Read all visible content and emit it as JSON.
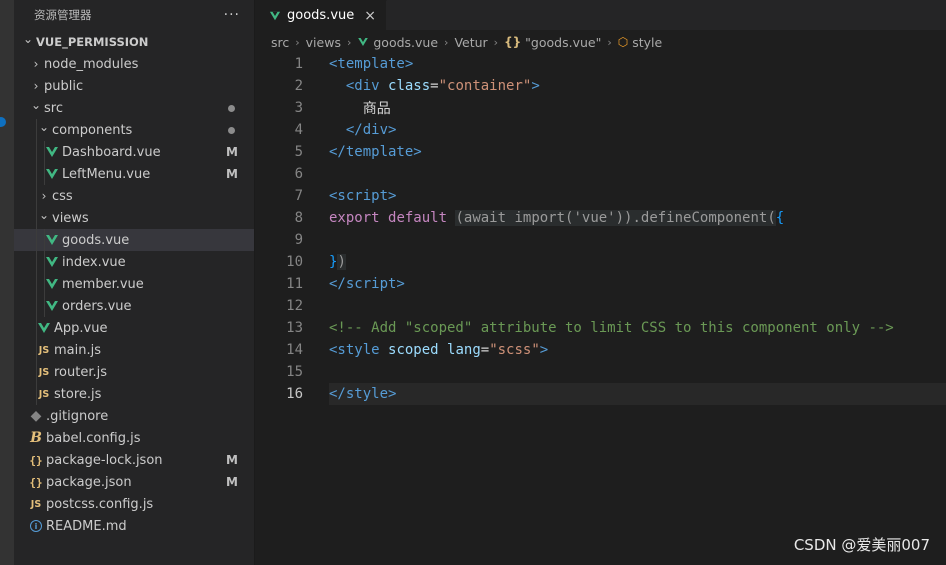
{
  "sidebar": {
    "title": "资源管理器",
    "more": "···",
    "tree": [
      {
        "label": "VUE_PERMISSION",
        "kind": "root",
        "depth": 0,
        "chevron": "open",
        "icon": "",
        "status": ""
      },
      {
        "label": "node_modules",
        "kind": "folder",
        "depth": 1,
        "chevron": "closed",
        "icon": "",
        "status": ""
      },
      {
        "label": "public",
        "kind": "folder",
        "depth": 1,
        "chevron": "closed",
        "icon": "",
        "status": ""
      },
      {
        "label": "src",
        "kind": "folder",
        "depth": 1,
        "chevron": "open",
        "icon": "",
        "status": "dot"
      },
      {
        "label": "components",
        "kind": "folder",
        "depth": 2,
        "chevron": "open",
        "icon": "",
        "status": "dot"
      },
      {
        "label": "Dashboard.vue",
        "kind": "file",
        "depth": 3,
        "chevron": "",
        "icon": "vue",
        "status": "M"
      },
      {
        "label": "LeftMenu.vue",
        "kind": "file",
        "depth": 3,
        "chevron": "",
        "icon": "vue",
        "status": "M"
      },
      {
        "label": "css",
        "kind": "folder",
        "depth": 2,
        "chevron": "closed",
        "icon": "",
        "status": ""
      },
      {
        "label": "views",
        "kind": "folder",
        "depth": 2,
        "chevron": "open",
        "icon": "",
        "status": ""
      },
      {
        "label": "goods.vue",
        "kind": "file",
        "depth": 3,
        "chevron": "",
        "icon": "vue",
        "status": "",
        "selected": true
      },
      {
        "label": "index.vue",
        "kind": "file",
        "depth": 3,
        "chevron": "",
        "icon": "vue",
        "status": ""
      },
      {
        "label": "member.vue",
        "kind": "file",
        "depth": 3,
        "chevron": "",
        "icon": "vue",
        "status": ""
      },
      {
        "label": "orders.vue",
        "kind": "file",
        "depth": 3,
        "chevron": "",
        "icon": "vue",
        "status": ""
      },
      {
        "label": "App.vue",
        "kind": "file",
        "depth": 2,
        "chevron": "",
        "icon": "vue",
        "status": ""
      },
      {
        "label": "main.js",
        "kind": "file",
        "depth": 2,
        "chevron": "",
        "icon": "js",
        "status": ""
      },
      {
        "label": "router.js",
        "kind": "file",
        "depth": 2,
        "chevron": "",
        "icon": "js",
        "status": ""
      },
      {
        "label": "store.js",
        "kind": "file",
        "depth": 2,
        "chevron": "",
        "icon": "js",
        "status": ""
      },
      {
        "label": ".gitignore",
        "kind": "file",
        "depth": 1,
        "chevron": "",
        "icon": "git",
        "status": ""
      },
      {
        "label": "babel.config.js",
        "kind": "file",
        "depth": 1,
        "chevron": "",
        "icon": "babel",
        "status": ""
      },
      {
        "label": "package-lock.json",
        "kind": "file",
        "depth": 1,
        "chevron": "",
        "icon": "json",
        "status": "M"
      },
      {
        "label": "package.json",
        "kind": "file",
        "depth": 1,
        "chevron": "",
        "icon": "json",
        "status": "M"
      },
      {
        "label": "postcss.config.js",
        "kind": "file",
        "depth": 1,
        "chevron": "",
        "icon": "js",
        "status": ""
      },
      {
        "label": "README.md",
        "kind": "file",
        "depth": 1,
        "chevron": "",
        "icon": "info",
        "status": ""
      }
    ]
  },
  "editor": {
    "tab": {
      "label": "goods.vue",
      "close": "×"
    },
    "breadcrumb": {
      "src": "src",
      "views": "views",
      "file": "goods.vue",
      "vetur": "Vetur",
      "brace": "{}",
      "block": "\"goods.vue\"",
      "style": "style"
    },
    "current_line": 16,
    "lines": [
      {
        "n": "1",
        "html": "<span class='t'>&lt;template&gt;</span>"
      },
      {
        "n": "2",
        "html": "  <span class='t'>&lt;div</span> <span class='a'>class</span><span class='txt'>=</span><span class='s'>\"container\"</span><span class='t'>&gt;</span>"
      },
      {
        "n": "3",
        "html": "    <span class='txt'>商品</span>"
      },
      {
        "n": "4",
        "html": "  <span class='t'>&lt;/div&gt;</span>"
      },
      {
        "n": "5",
        "html": "<span class='t'>&lt;/template&gt;</span>"
      },
      {
        "n": "6",
        "html": ""
      },
      {
        "n": "7",
        "html": "<span class='t'>&lt;script&gt;</span>"
      },
      {
        "n": "8",
        "html": "<span class='kw'>export</span> <span class='kw'>default</span> <span class='fade'>(await import('vue')).defineComponent(</span><span class='br2'>{</span>"
      },
      {
        "n": "9",
        "html": ""
      },
      {
        "n": "10",
        "html": "<span class='br2'>}</span><span class='fade'>)</span>"
      },
      {
        "n": "11",
        "html": "<span class='t'>&lt;/script&gt;</span>"
      },
      {
        "n": "12",
        "html": ""
      },
      {
        "n": "13",
        "html": "<span class='cm'>&lt;!-- Add \"scoped\" attribute to limit CSS to this component only --&gt;</span>"
      },
      {
        "n": "14",
        "html": "<span class='t'>&lt;style</span> <span class='a'>scoped</span> <span class='a'>lang</span><span class='txt'>=</span><span class='s'>\"scss\"</span><span class='t'>&gt;</span>"
      },
      {
        "n": "15",
        "html": ""
      },
      {
        "n": "16",
        "html": "<span class='t'>&lt;/style&gt;</span>"
      }
    ]
  },
  "watermark": "CSDN @爱美丽007"
}
